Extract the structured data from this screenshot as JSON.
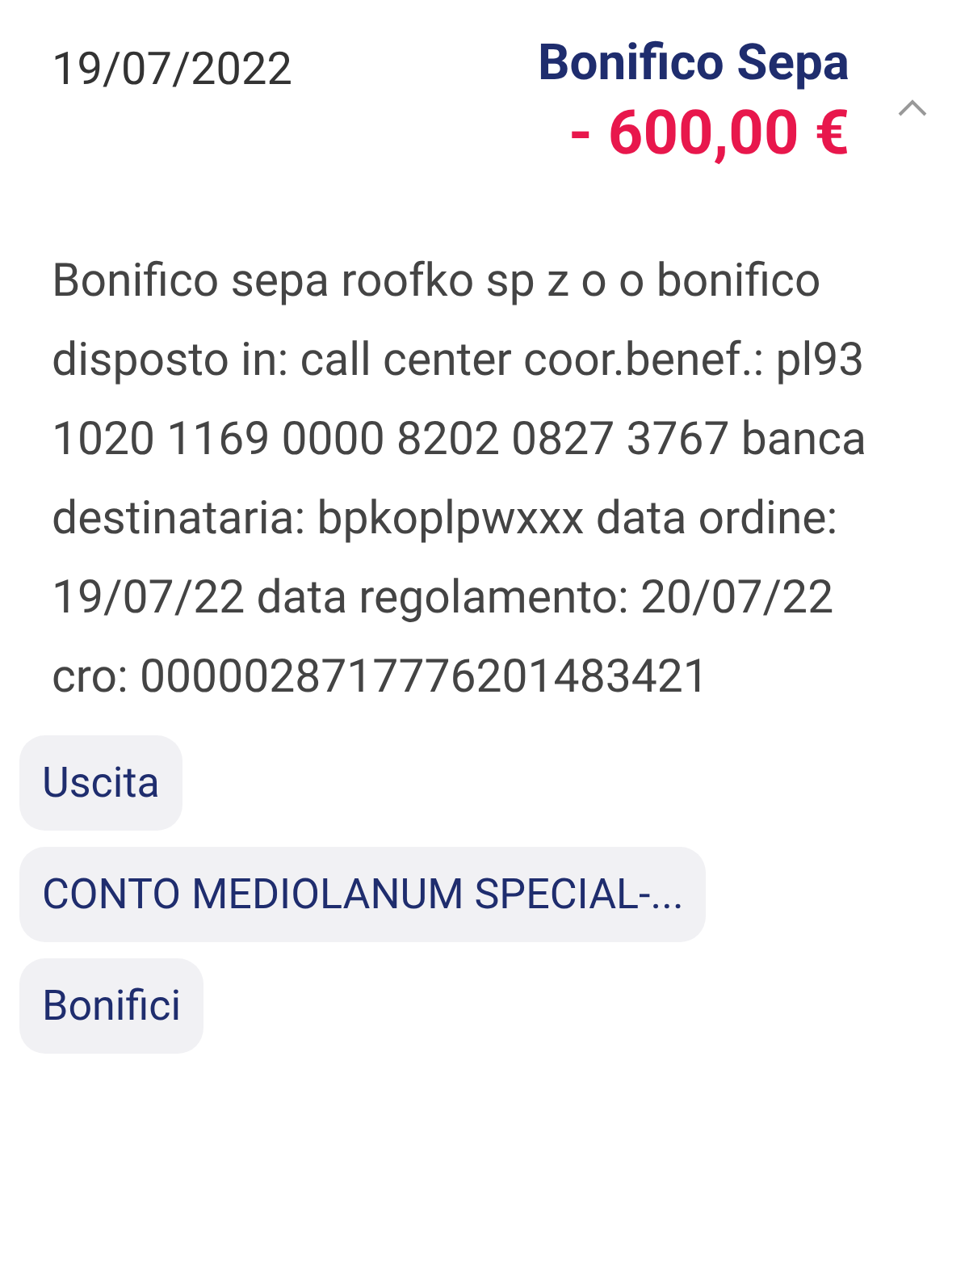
{
  "transaction": {
    "date": "19/07/2022",
    "title": "Bonifico Sepa",
    "amount": "- 600,00 €",
    "expanded": true,
    "description": "Bonifico sepa roofko sp z o o bonifico disposto in: call center coor.benef.: pl93 1020 1169 0000 8202 0827 3767 banca destinataria: bpkoplpwxxx data ordine: 19/07/22 data regolamento: 20/07/22 cro: 0000028717776201483421"
  },
  "tags": [
    {
      "label": "Uscita"
    },
    {
      "label": "CONTO MEDIOLANUM SPECIAL-..."
    },
    {
      "label": "Bonifici"
    }
  ]
}
